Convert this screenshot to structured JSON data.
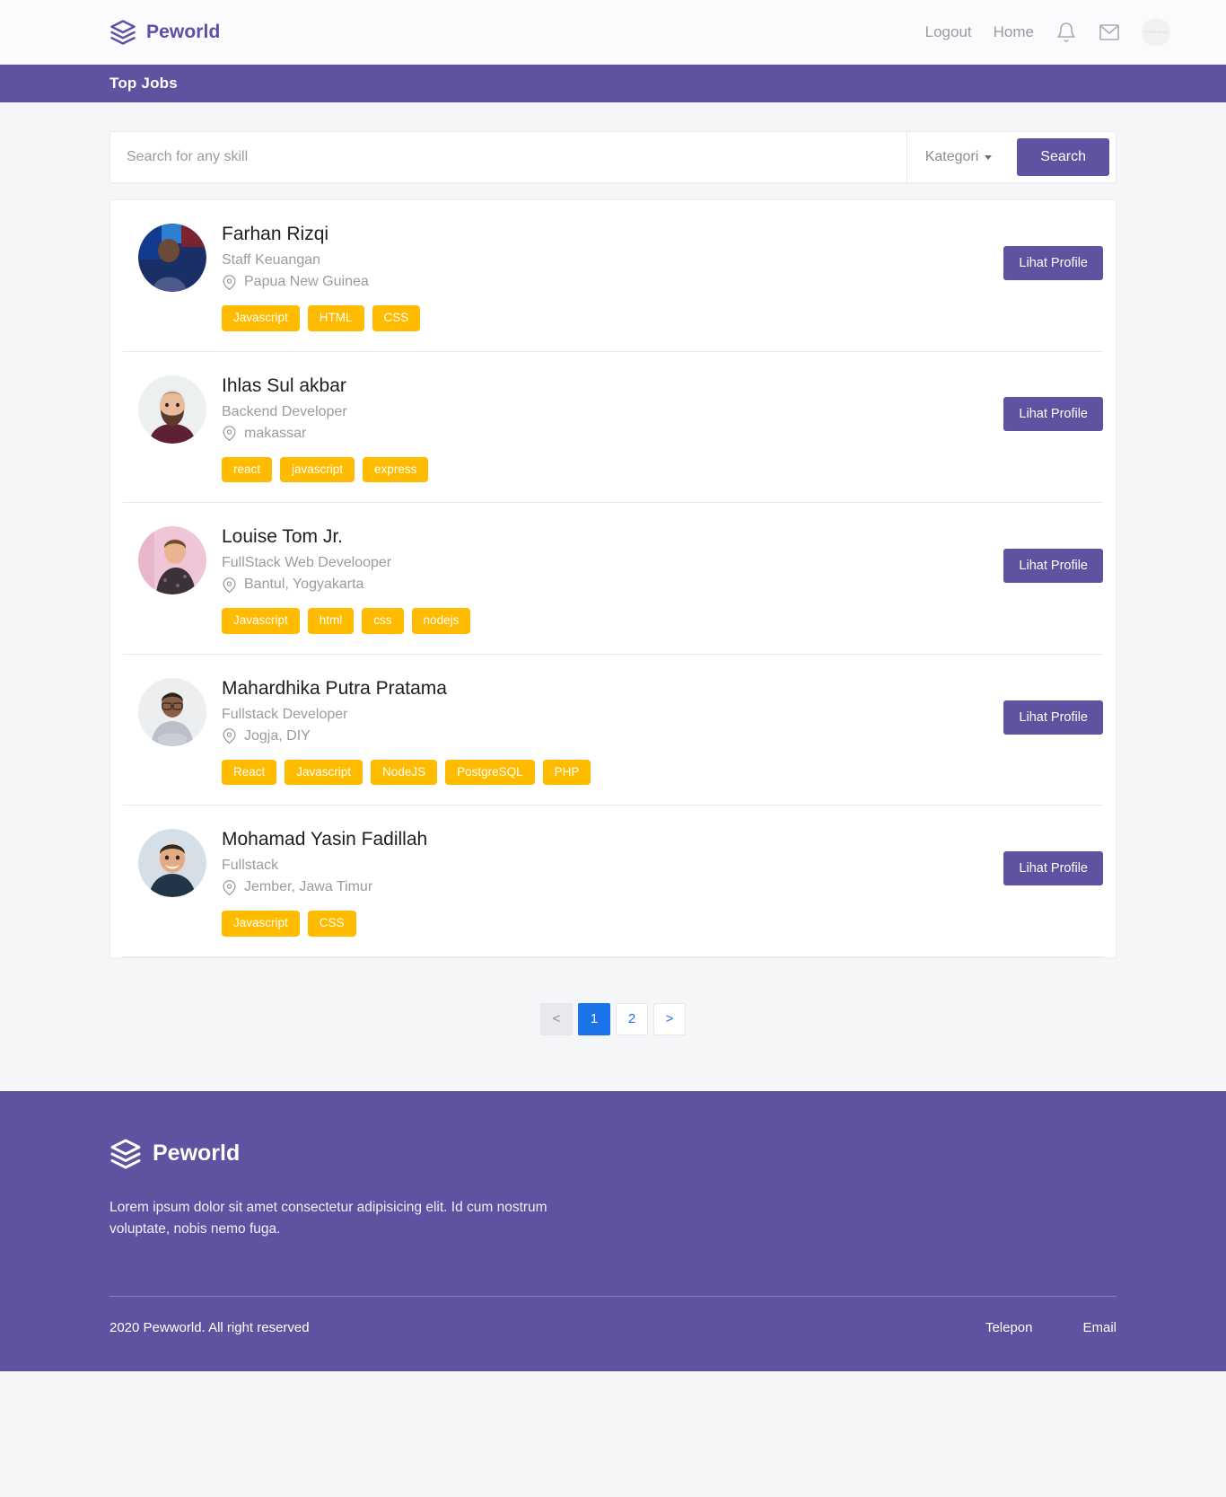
{
  "brand": {
    "name": "Peworld",
    "logo_icon": "layers-icon",
    "color": "#5f52a0"
  },
  "navbar": {
    "logout_label": "Logout",
    "home_label": "Home",
    "bell_icon": "bell-icon",
    "mail_icon": "envelope-icon",
    "avatar_alt": "broken image"
  },
  "page_title": "Top Jobs",
  "search": {
    "placeholder": "Search for any skill",
    "value": "",
    "category_label": "Kategori",
    "category_icon": "chevron-down-icon",
    "button_label": "Search"
  },
  "results": {
    "profile_button_label": "Lihat Profile",
    "location_icon": "map-pin-icon",
    "workers": [
      {
        "name": "Farhan Rizqi",
        "role": "Staff Keuangan",
        "location": "Papua New Guinea",
        "skills": [
          "Javascript",
          "HTML",
          "CSS"
        ],
        "avatar_style": "photo-dark-blue"
      },
      {
        "name": "Ihlas Sul akbar",
        "role": "Backend Developer",
        "location": "makassar",
        "skills": [
          "react",
          "javascript",
          "express"
        ],
        "avatar_style": "photo-bearded-man"
      },
      {
        "name": "Louise Tom Jr.",
        "role": "FullStack Web Develooper",
        "location": "Bantul, Yogyakarta",
        "skills": [
          "Javascript",
          "html",
          "css",
          "nodejs"
        ],
        "avatar_style": "photo-pink-bg"
      },
      {
        "name": "Mahardhika Putra Pratama",
        "role": "Fullstack Developer",
        "location": "Jogja, DIY",
        "skills": [
          "React",
          "Javascript",
          "NodeJS",
          "PostgreSQL",
          "PHP"
        ],
        "avatar_style": "photo-glasses-man"
      },
      {
        "name": "Mohamad Yasin Fadillah",
        "role": "Fullstack",
        "location": "Jember, Jawa Timur",
        "skills": [
          "Javascript",
          "CSS"
        ],
        "avatar_style": "photo-smiling-man"
      }
    ]
  },
  "pagination": {
    "prev_label": "<",
    "next_label": ">",
    "pages": [
      "1",
      "2"
    ],
    "active_page": "1",
    "active_color": "#1a73e8"
  },
  "footer": {
    "brand_name": "Peworld",
    "description": "Lorem ipsum dolor sit amet consectetur adipisicing elit. Id cum nostrum voluptate, nobis nemo fuga.",
    "copyright": "2020 Pewworld. All right reserved",
    "link_phone": "Telepon",
    "link_email": "Email",
    "background": "#5f52a0"
  },
  "theme": {
    "primary": "#5f52a0",
    "tag": "#ffbb00",
    "page_bg": "#f5f6f8"
  }
}
